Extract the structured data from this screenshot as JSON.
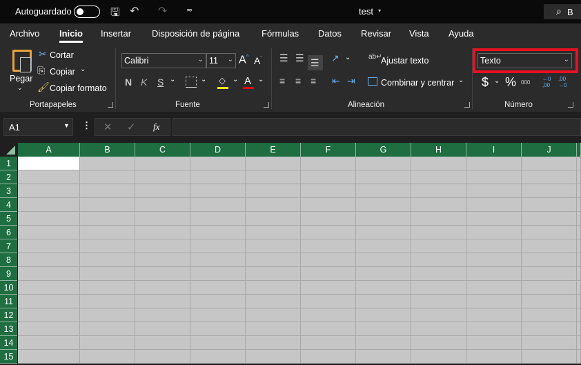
{
  "titlebar": {
    "autosave_label": "Autoguardado",
    "autosave_on": false,
    "doc_title": "test",
    "search_partial": "B"
  },
  "tabs": [
    "Archivo",
    "Inicio",
    "Insertar",
    "Disposición de página",
    "Fórmulas",
    "Datos",
    "Revisar",
    "Vista",
    "Ayuda"
  ],
  "active_tab": "Inicio",
  "clipboard": {
    "paste": "Pegar",
    "cut": "Cortar",
    "copy": "Copiar",
    "format_painter": "Copiar formato",
    "group": "Portapapeles"
  },
  "font": {
    "name": "Calibri",
    "size": "11",
    "bold": "N",
    "italic": "K",
    "underline": "S",
    "group": "Fuente",
    "highlight_color": "#ffff00",
    "font_color": "#ff0000"
  },
  "alignment": {
    "wrap": "Ajustar texto",
    "merge": "Combinar y centrar",
    "group": "Alineación"
  },
  "number": {
    "format": "Texto",
    "currency": "$",
    "percent": "%",
    "thousands": "000",
    "group": "Número",
    "highlight_box_color": "#e81123"
  },
  "formula_bar": {
    "name_box": "A1",
    "fx": "fx",
    "value": ""
  },
  "grid": {
    "columns": [
      "A",
      "B",
      "C",
      "D",
      "E",
      "F",
      "G",
      "H",
      "I",
      "J"
    ],
    "rows": [
      "1",
      "2",
      "3",
      "4",
      "5",
      "6",
      "7",
      "8",
      "9",
      "10",
      "11",
      "12",
      "13",
      "14",
      "15"
    ],
    "selected_cell": "A1"
  }
}
